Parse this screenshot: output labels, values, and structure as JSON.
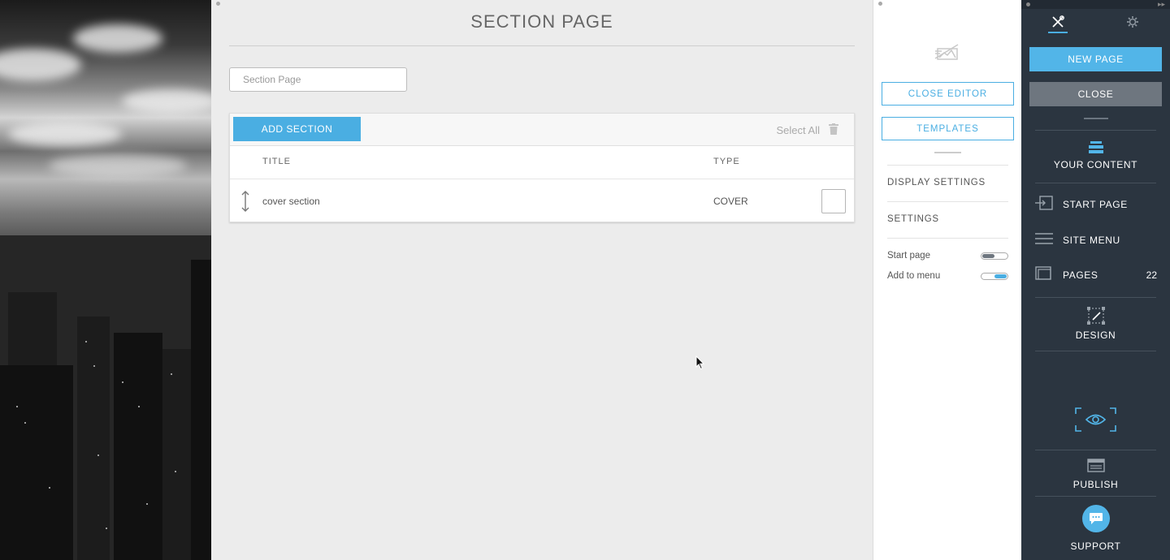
{
  "main": {
    "title": "SECTION PAGE",
    "page_name_placeholder": "Section Page",
    "toolbar": {
      "add_section_label": "ADD SECTION",
      "select_all_label": "Select All"
    },
    "columns": {
      "title": "TITLE",
      "type": "TYPE"
    },
    "rows": [
      {
        "title": "cover section",
        "type": "COVER"
      }
    ]
  },
  "settings": {
    "close_editor_label": "CLOSE EDITOR",
    "templates_label": "TEMPLATES",
    "display_settings_label": "DISPLAY SETTINGS",
    "settings_label": "SETTINGS",
    "toggles": [
      {
        "label": "Start page",
        "on": false
      },
      {
        "label": "Add to menu",
        "on": true
      }
    ]
  },
  "sidebar": {
    "new_page_label": "NEW PAGE",
    "close_label": "CLOSE",
    "your_content_label": "YOUR CONTENT",
    "items": [
      {
        "label": "START PAGE",
        "icon": "start-page-icon"
      },
      {
        "label": "SITE MENU",
        "icon": "menu-icon"
      },
      {
        "label": "PAGES",
        "icon": "pages-icon",
        "count": "22"
      }
    ],
    "design_label": "DESIGN",
    "publish_label": "PUBLISH",
    "support_label": "SUPPORT"
  },
  "colors": {
    "accent": "#4aaee2",
    "sidebar_bg": "#2b3540",
    "close_button": "#6e767f"
  }
}
